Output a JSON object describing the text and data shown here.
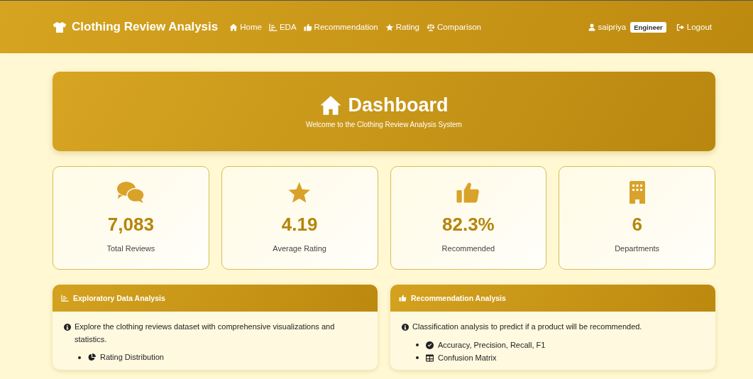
{
  "navbar": {
    "brand": "Clothing Review Analysis",
    "links": [
      {
        "label": "Home",
        "selected": false
      },
      {
        "label": "EDA",
        "selected": false
      },
      {
        "label": "Recommendation",
        "selected": false
      },
      {
        "label": "Rating",
        "selected": false
      },
      {
        "label": "Comparison",
        "selected": false
      }
    ],
    "user": {
      "name": "saipriya",
      "role": "Engineer"
    },
    "logout": "Logout"
  },
  "hero": {
    "title": "Dashboard",
    "subtitle": "Welcome to the Clothing Review Analysis System"
  },
  "stats": [
    {
      "value": "7,083",
      "label": "Total Reviews"
    },
    {
      "value": "4.19",
      "label": "Average Rating"
    },
    {
      "value": "82.3%",
      "label": "Recommended"
    },
    {
      "value": "6",
      "label": "Departments"
    }
  ],
  "panels": [
    {
      "title": "Exploratory Data Analysis",
      "description": "Explore the clothing reviews dataset with comprehensive visualizations and statistics.",
      "items": [
        "Rating Distribution"
      ]
    },
    {
      "title": "Recommendation Analysis",
      "description": "Classification analysis to predict if a product will be recommended.",
      "items": [
        "Accuracy, Precision, Recall, F1",
        "Confusion Matrix"
      ]
    }
  ]
}
